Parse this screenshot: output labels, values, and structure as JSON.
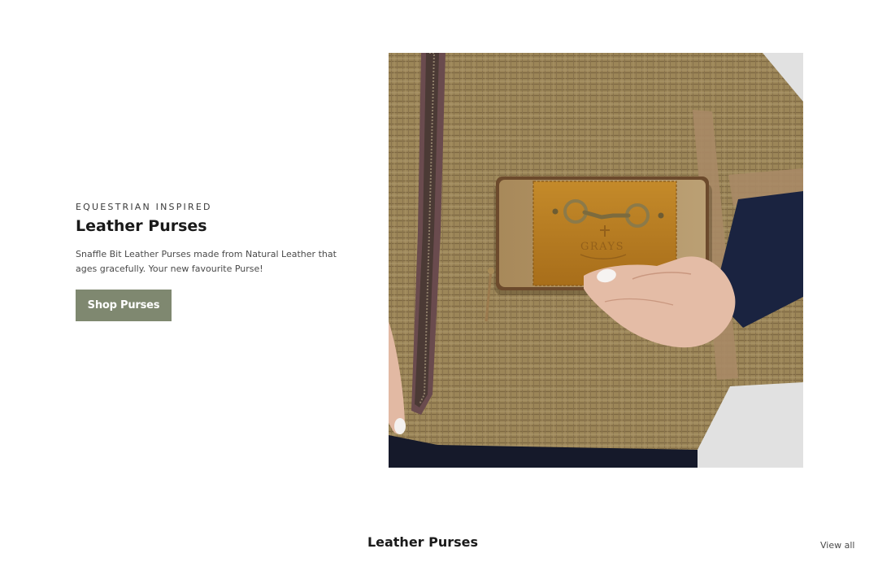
{
  "promo": {
    "eyebrow": "EQUESTRIAN INSPIRED",
    "title": "Leather Purses",
    "description": "Snaffle Bit Leather Purses made from Natural Leather that ages gracefully. Your new favourite Purse!",
    "button_label": "Shop Purses",
    "button_color": "#7f8870"
  },
  "product_image": {
    "brand_stamp": "GRAYS"
  },
  "collection": {
    "title": "Leather Purses",
    "view_all_label": "View all"
  }
}
